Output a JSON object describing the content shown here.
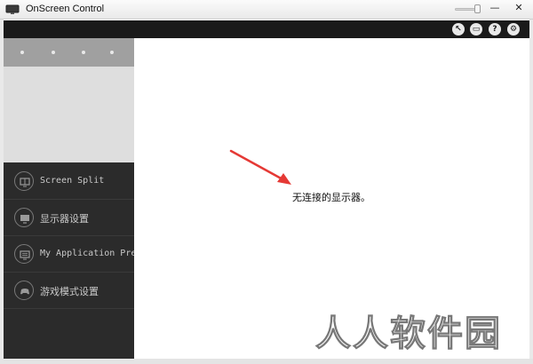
{
  "window": {
    "title": "OnScreen Control",
    "minimize_glyph": "—",
    "close_glyph": "✕"
  },
  "toolbar": {
    "icons": [
      "cursor-icon",
      "window-icon",
      "help-icon",
      "gear-icon"
    ],
    "help_glyph": "?",
    "gear_glyph": "⚙",
    "cursor_glyph": "↖",
    "window_glyph": "▭"
  },
  "sidebar": {
    "items": [
      {
        "label": "Screen Split",
        "icon": "monitor-split-icon"
      },
      {
        "label": "显示器设置",
        "icon": "monitor-icon"
      },
      {
        "label": "My Application Preset",
        "icon": "app-preset-icon"
      },
      {
        "label": "游戏模式设置",
        "icon": "gamepad-icon"
      }
    ]
  },
  "main": {
    "status_message": "无连接的显示器。"
  },
  "watermark": "人人软件园",
  "colors": {
    "toolbar_bg": "#1a1a1a",
    "sidebar_bg": "#2b2b2b",
    "arrow": "#e53935"
  }
}
